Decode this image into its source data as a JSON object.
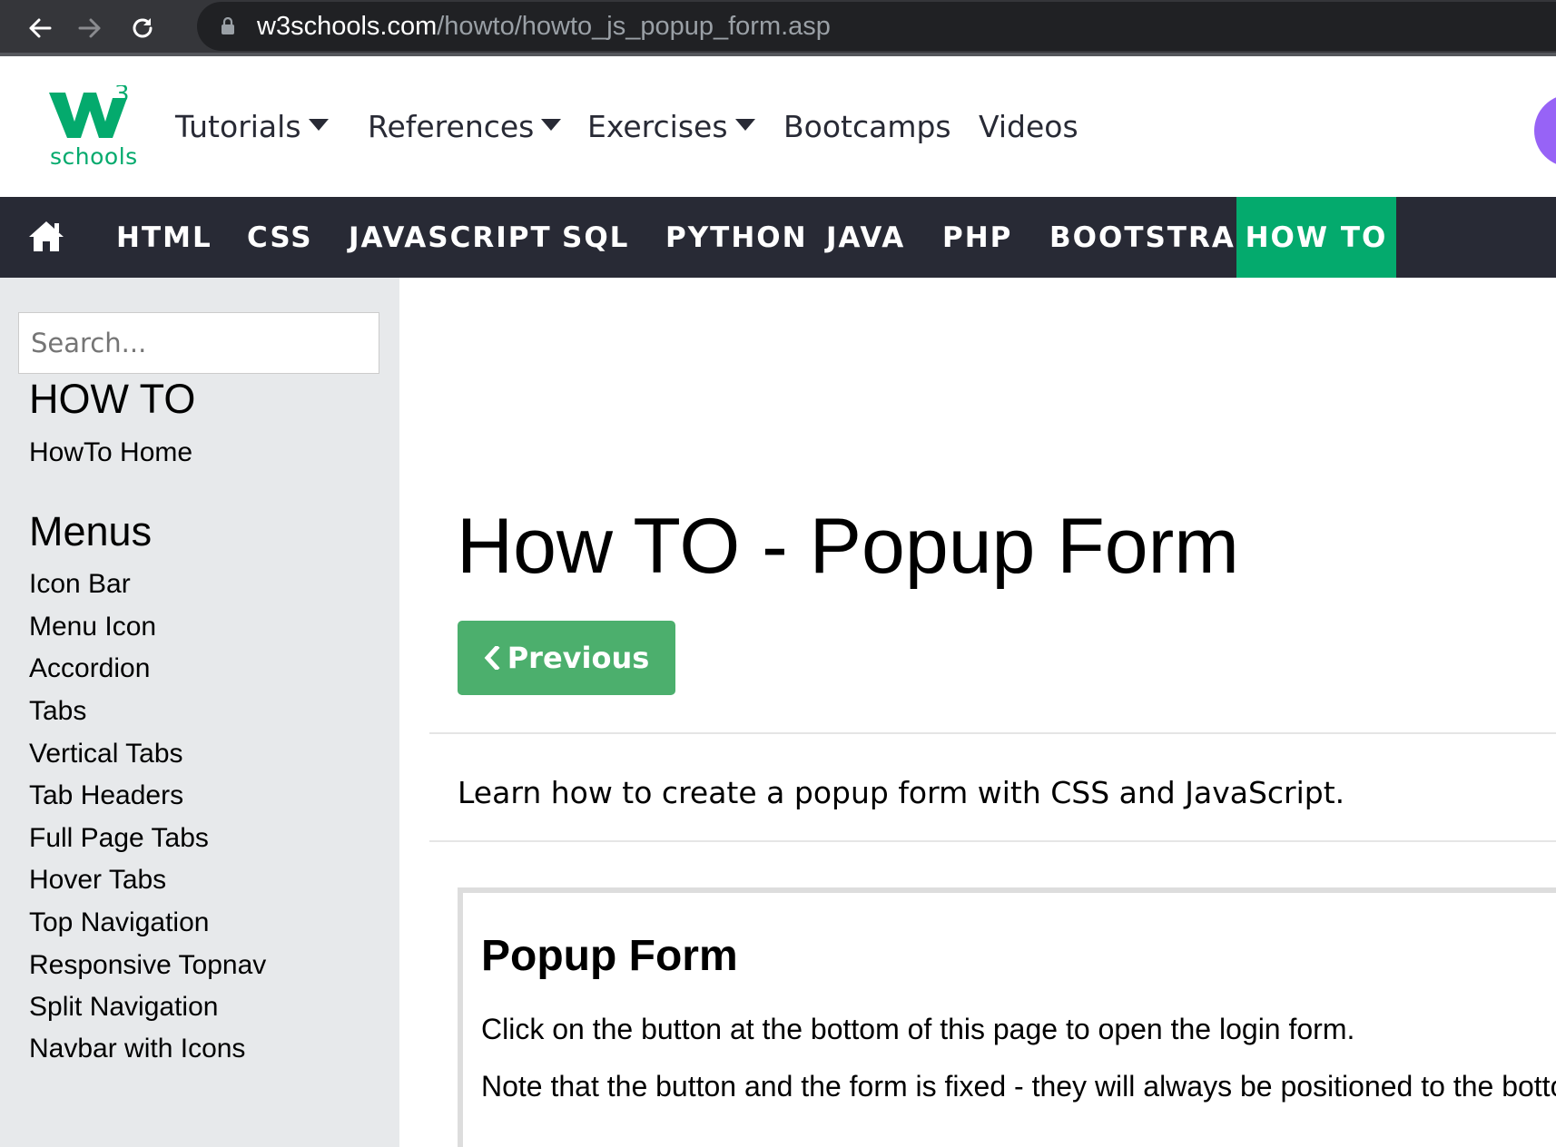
{
  "browser": {
    "url_domain": "w3schools.com",
    "url_path": "/howto/howto_js_popup_form.asp"
  },
  "header": {
    "logo_text": "schools",
    "nav": [
      {
        "label": "Tutorials"
      },
      {
        "label": "References"
      },
      {
        "label": "Exercises"
      },
      {
        "label": "Bootcamps"
      },
      {
        "label": "Videos"
      }
    ]
  },
  "subnav": {
    "items": [
      "HTML",
      "CSS",
      "JAVASCRIPT",
      "SQL",
      "PYTHON",
      "JAVA",
      "PHP",
      "BOOTSTRAP",
      "HOW TO"
    ],
    "active": "HOW TO"
  },
  "sidebar": {
    "search_placeholder": "Search...",
    "section1_title": "HOW TO",
    "section1_links": [
      "HowTo Home"
    ],
    "section2_title": "Menus",
    "section2_links": [
      "Icon Bar",
      "Menu Icon",
      "Accordion",
      "Tabs",
      "Vertical Tabs",
      "Tab Headers",
      "Full Page Tabs",
      "Hover Tabs",
      "Top Navigation",
      "Responsive Topnav",
      "Split Navigation",
      "Navbar with Icons"
    ]
  },
  "main": {
    "title": "How TO - Popup Form",
    "previous_label": "Previous",
    "intro": "Learn how to create a popup form with CSS and JavaScript.",
    "example": {
      "title": "Popup Form",
      "p1": "Click on the button at the bottom of this page to open the login form.",
      "p2": "Note that the button and the form is fixed - they will always be positioned to the bottom of the page."
    }
  },
  "colors": {
    "chrome_bg": "#35363a",
    "url_bg": "#202124",
    "subnav_bg": "#282a35",
    "accent_green": "#04aa6d",
    "button_green": "#4caf6d",
    "sidebar_bg": "#e7e9eb",
    "avatar_purple": "#9763f6"
  },
  "icons": {
    "back": "arrow-left-icon",
    "forward": "arrow-right-icon",
    "reload": "reload-icon",
    "lock": "lock-icon",
    "home": "home-icon",
    "dropdown": "caret-down-icon",
    "previous": "chevron-left-icon"
  }
}
